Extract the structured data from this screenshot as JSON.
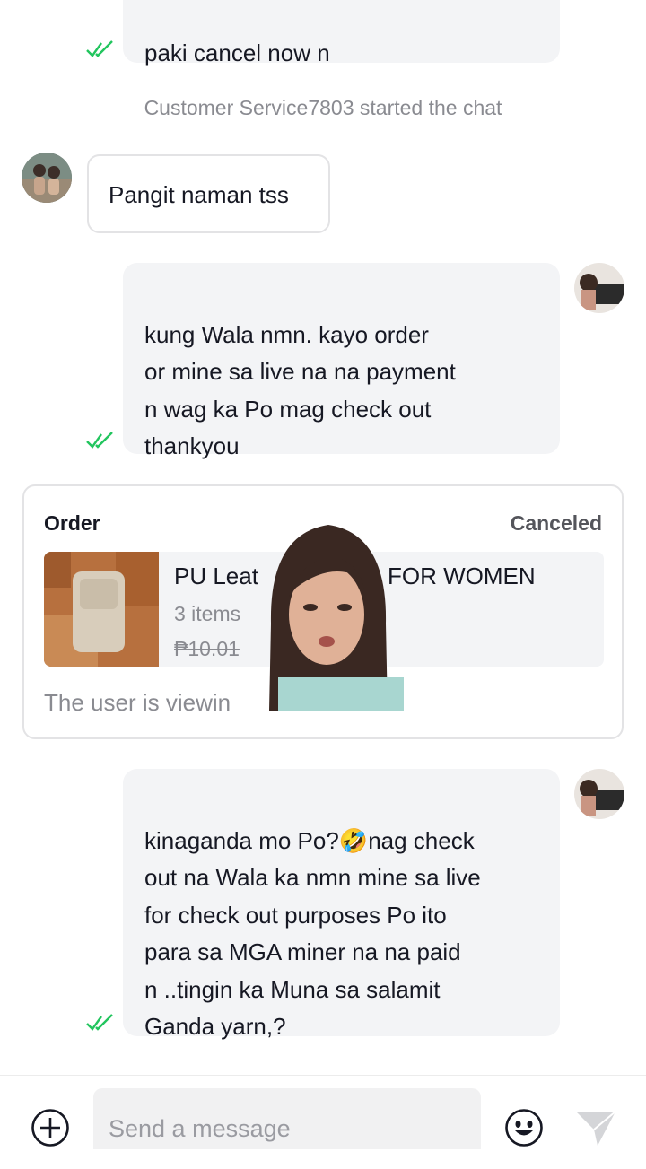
{
  "messages": {
    "top_message": "paki cancel now n",
    "system_notice": "Customer Service7803 started the chat",
    "incoming_message": "Pangit naman tss",
    "outgoing_1": "kung Wala nmn. kayo order\nor mine sa live na na payment\nn wag ka Po mag check out\nthankyou",
    "outgoing_2": "kinaganda mo Po?🤣nag check\nout na Wala ka nmn mine sa live\nfor check out purposes Po ito\npara sa MGA miner na na paid\nn ..tingin ka Muna sa salamit\nGanda yarn,?"
  },
  "order_card": {
    "title": "Order",
    "status": "Canceled",
    "product_name_left": "PU Leat",
    "product_name_right": "FOR WOMEN",
    "items": "3 items",
    "price": "₱10.01",
    "viewing_note": "The user is viewin"
  },
  "composer": {
    "placeholder": "Send a message",
    "add_icon": "plus-circle-icon",
    "emoji_icon": "emoji-icon",
    "send_icon": "send-icon"
  },
  "colors": {
    "read_check": "#22c55e",
    "bubble_bg": "#f3f4f6",
    "secondary_text": "#8a8b91"
  }
}
